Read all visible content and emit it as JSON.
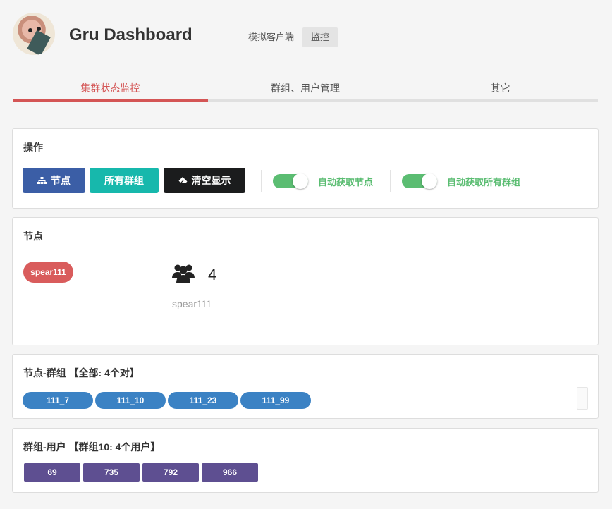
{
  "header": {
    "title": "Gru Dashboard",
    "nav": [
      {
        "label": "模拟客户端",
        "active": false
      },
      {
        "label": "监控",
        "active": true
      }
    ]
  },
  "tabs": [
    {
      "label": "集群状态监控",
      "active": true
    },
    {
      "label": "群组、用户管理",
      "active": false
    },
    {
      "label": "其它",
      "active": false
    }
  ],
  "operations": {
    "title": "操作",
    "btn_nodes": {
      "label": "节点",
      "icon": "sitemap-icon"
    },
    "btn_groups": {
      "label": "所有群组"
    },
    "btn_clear": {
      "label": "清空显示",
      "icon": "eraser-icon"
    },
    "toggle_nodes": {
      "label": "自动获取节点",
      "on": true
    },
    "toggle_groups": {
      "label": "自动获取所有群组",
      "on": true
    }
  },
  "nodes": {
    "title": "节点",
    "node_tag": "spear111",
    "user_count": "4",
    "node_name": "spear111",
    "icon": "users-icon"
  },
  "node_groups": {
    "title": "节点-群组 【全部: 4个对】",
    "items": [
      "111_7",
      "111_10",
      "111_23",
      "111_99"
    ]
  },
  "group_users": {
    "title": "群组-用户 【群组10: 4个用户】",
    "items": [
      "69",
      "735",
      "792",
      "966"
    ]
  },
  "colors": {
    "accent_red": "#d45555",
    "btn_blue": "#3b5ea6",
    "btn_teal": "#17b8ac",
    "btn_black": "#1b1c1d",
    "toggle_green": "#5bbd72",
    "pill_blue": "#3b82c4",
    "tag_purple": "#5e4f91"
  }
}
